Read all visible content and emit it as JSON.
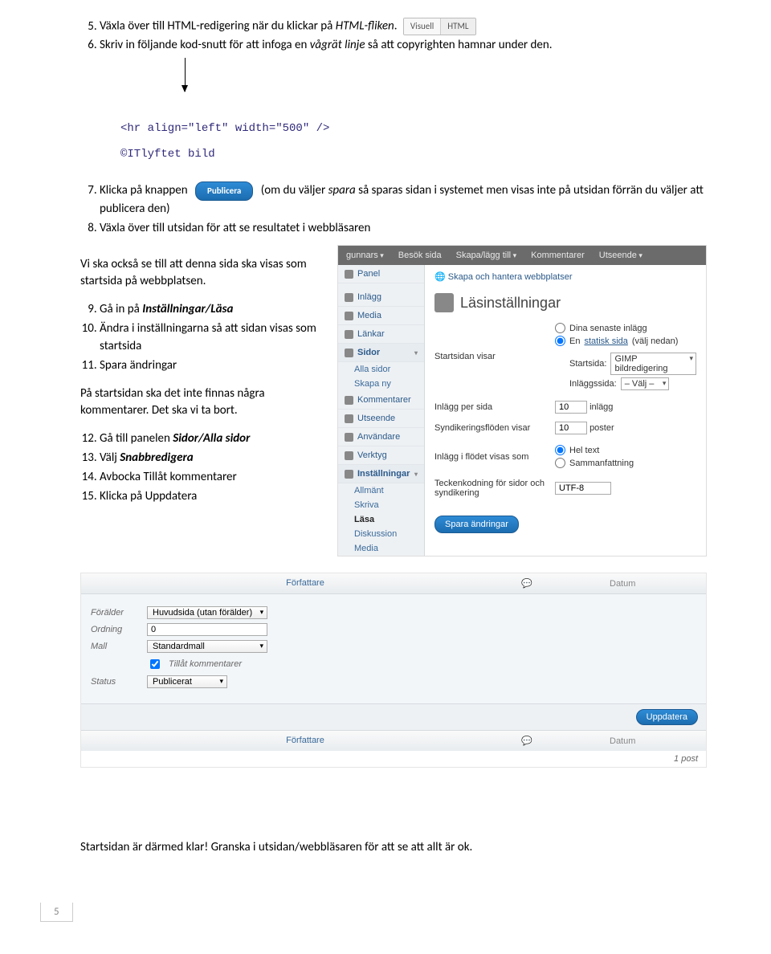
{
  "steps": {
    "s5a": "Växla över till HTML-redigering när du klickar på ",
    "s5b": "HTML-fliken",
    "s5c": ".",
    "s6a": "Skriv in följande kod-snutt för att infoga en ",
    "s6b": "vågrät linje",
    "s6c": " så att copyrighten hamnar under den.",
    "s7a": "Klicka på knappen ",
    "s7b": " (om du väljer ",
    "s7c": "spara",
    "s7d": " så sparas sidan i systemet men visas inte på utsidan förrän du väljer att publicera den)",
    "s8": "Växla över till utsidan för att se resultatet i webbläsaren",
    "s9a": "Gå in på ",
    "s9b": "Inställningar/Läsa",
    "s10": "Ändra i inställningarna så att sidan visas som startsida",
    "s11": "Spara ändringar",
    "s12a": "Gå till panelen ",
    "s12b": "Sidor/Alla sidor",
    "s13a": "Välj ",
    "s13b": "Snabbredigera",
    "s14": "Avbocka Tillåt kommentarer",
    "s15": "Klicka på Uppdatera"
  },
  "tabs": {
    "visual": "Visuell",
    "html": "HTML"
  },
  "publish_label": "Publicera",
  "code": "<hr align=\"left\" width=\"500\" />\n\n©ITlyftet bild",
  "para1": "Vi ska också se till att denna sida ska visas som startsida på webbplatsen.",
  "para2": "På startsidan ska det inte finnas några kommentarer. Det ska vi ta bort.",
  "closing": "Startsidan är därmed klar! Granska i utsidan/webbläsaren för att se att allt är ok.",
  "page_number": "5",
  "wp": {
    "topbar": [
      "gunnars",
      "Besök sida",
      "Skapa/lägg till",
      "Kommentarer",
      "Utseende"
    ],
    "sidebar": {
      "panel": "Panel",
      "items": [
        "Inlägg",
        "Media",
        "Länkar"
      ],
      "sidor": "Sidor",
      "sidor_sub": [
        "Alla sidor",
        "Skapa ny"
      ],
      "kommentarer": "Kommentarer",
      "utseende": "Utseende",
      "anvandare": "Användare",
      "verktyg": "Verktyg",
      "installningar": "Inställningar",
      "inst_sub": [
        "Allmänt",
        "Skriva",
        "Läsa",
        "Diskussion",
        "Media"
      ]
    },
    "main": {
      "crumb": "Skapa och hantera webbplatser",
      "title": "Läsinställningar",
      "startsida_label": "Startsidan visar",
      "opt1": "Dina senaste inlägg",
      "opt2a": "En ",
      "opt2b": "statisk sida",
      "opt2c": " (välj nedan)",
      "startsida": "Startsida:",
      "startsida_val": "GIMP bildredigering",
      "inlaggsida": "Inläggssida:",
      "inlaggsida_val": "– Välj –",
      "inlagg_per_sida": "Inlägg per sida",
      "inlagg_val": "10",
      "inlagg_unit": "inlägg",
      "synd": "Syndikeringsflöden visar",
      "synd_val": "10",
      "synd_unit": "poster",
      "flod_label": "Inlägg i flödet visas som",
      "flod_opt1": "Hel text",
      "flod_opt2": "Sammanfattning",
      "teck_label": "Teckenkodning för sidor och syndikering",
      "teck_val": "UTF-8",
      "save": "Spara ändringar"
    }
  },
  "qe": {
    "head_author": "Författare",
    "head_date": "Datum",
    "foralder": "Förälder",
    "foralder_val": "Huvudsida (utan förälder)",
    "ordning": "Ordning",
    "ordning_val": "0",
    "mall": "Mall",
    "mall_val": "Standardmall",
    "tillat": "Tillåt kommentarer",
    "status": "Status",
    "status_val": "Publicerat",
    "update": "Uppdatera",
    "count": "1 post"
  }
}
